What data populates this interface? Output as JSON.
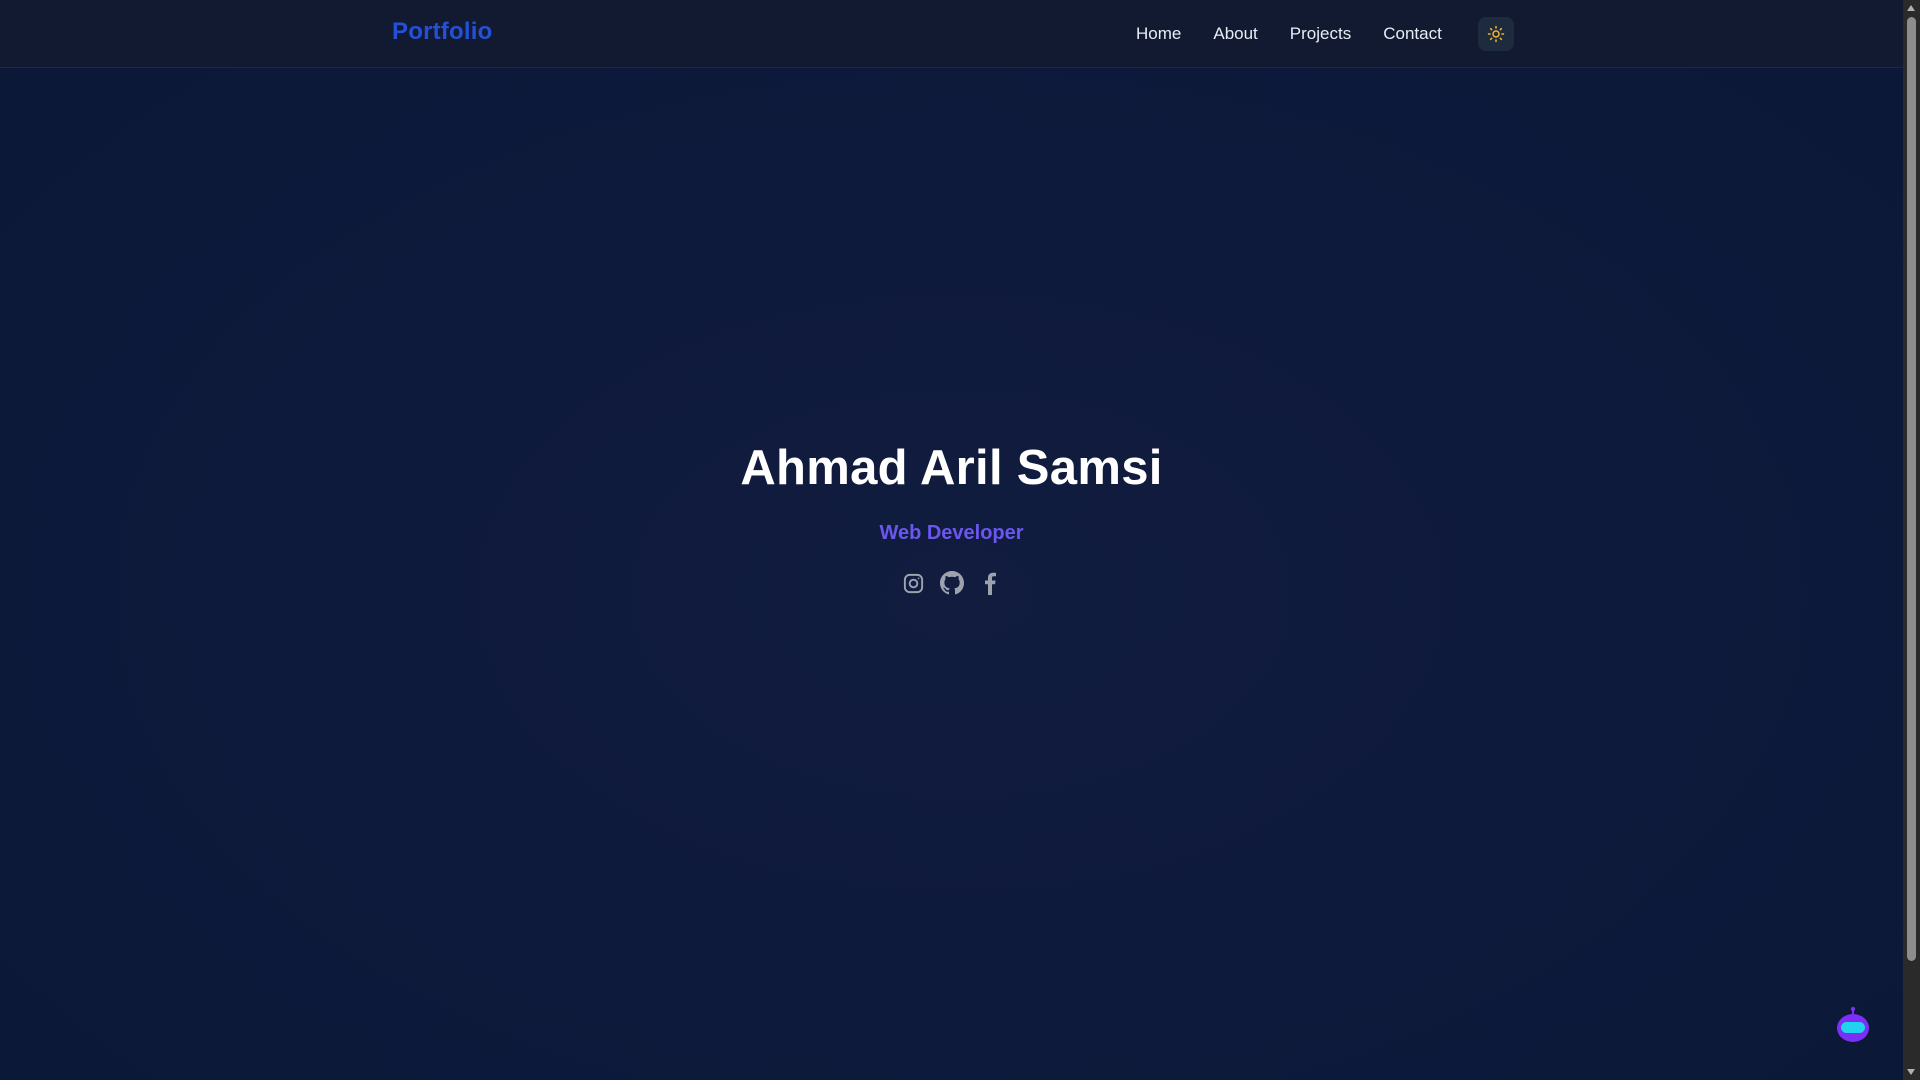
{
  "navbar": {
    "brand": "Portfolio",
    "links": [
      {
        "label": "Home"
      },
      {
        "label": "About"
      },
      {
        "label": "Projects"
      },
      {
        "label": "Contact"
      }
    ],
    "theme_toggle_icon": "sun-icon"
  },
  "hero": {
    "name": "Ahmad Aril Samsi",
    "role": "Web Developer",
    "socials": [
      {
        "icon": "instagram-icon"
      },
      {
        "icon": "github-icon"
      },
      {
        "icon": "facebook-icon"
      }
    ]
  },
  "chat_widget": {
    "icon": "robot-icon"
  },
  "colors": {
    "background": "#0e1a3c",
    "navbar": "#111a30",
    "brand": "#2450d8",
    "role": "#6b56f0",
    "sun": "#f2b632",
    "robot": "#7b2ff7",
    "robot_visor": "#22d3ee"
  }
}
